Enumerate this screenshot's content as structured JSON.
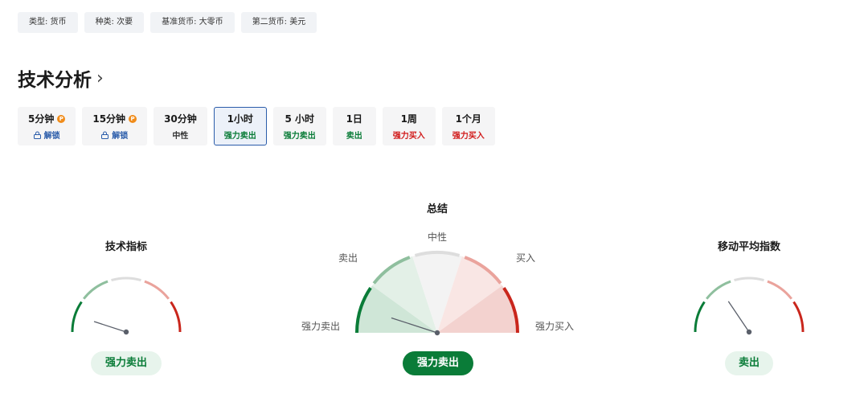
{
  "tags": [
    "类型: 货币",
    "种类: 次要",
    "基准货币: 大零币",
    "第二货币: 美元"
  ],
  "section_title": "技术分析",
  "timeframes": [
    {
      "label": "5分钟",
      "status": "解锁",
      "kind": "lock",
      "pro": true,
      "active": false
    },
    {
      "label": "15分钟",
      "status": "解锁",
      "kind": "lock",
      "pro": true,
      "active": false
    },
    {
      "label": "30分钟",
      "status": "中性",
      "kind": "neutral",
      "pro": false,
      "active": false
    },
    {
      "label": "1小时",
      "status": "强力卖出",
      "kind": "sell",
      "pro": false,
      "active": true
    },
    {
      "label": "5 小时",
      "status": "强力卖出",
      "kind": "sell",
      "pro": false,
      "active": false
    },
    {
      "label": "1日",
      "status": "卖出",
      "kind": "sell",
      "pro": false,
      "active": false
    },
    {
      "label": "1周",
      "status": "强力买入",
      "kind": "buy",
      "pro": false,
      "active": false
    },
    {
      "label": "1个月",
      "status": "强力买入",
      "kind": "buy",
      "pro": false,
      "active": false
    }
  ],
  "pro_badge": "P",
  "gauges": {
    "indicators": {
      "title": "技术指标",
      "result": "强力卖出"
    },
    "summary": {
      "title": "总结",
      "result": "强力卖出",
      "labels": {
        "neutral": "中性",
        "sell": "卖出",
        "buy": "买入",
        "strong_sell": "强力卖出",
        "strong_buy": "强力买入"
      }
    },
    "moving_averages": {
      "title": "移动平均指数",
      "result": "卖出"
    }
  },
  "colors": {
    "strong_sell": "#0a7c38",
    "sell": "#8fbf9e",
    "neutral": "#dddddd",
    "buy": "#eaa39c",
    "strong_buy": "#c9261c",
    "needle": "#5a5f6a",
    "active_border": "#2a5caa"
  }
}
